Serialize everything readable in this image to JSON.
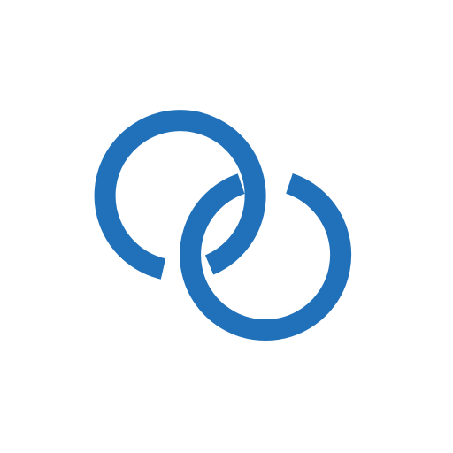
{
  "icon": {
    "name": "interlocking-rings-icon",
    "color": "#2171BA",
    "background": "#FFFFFF"
  }
}
